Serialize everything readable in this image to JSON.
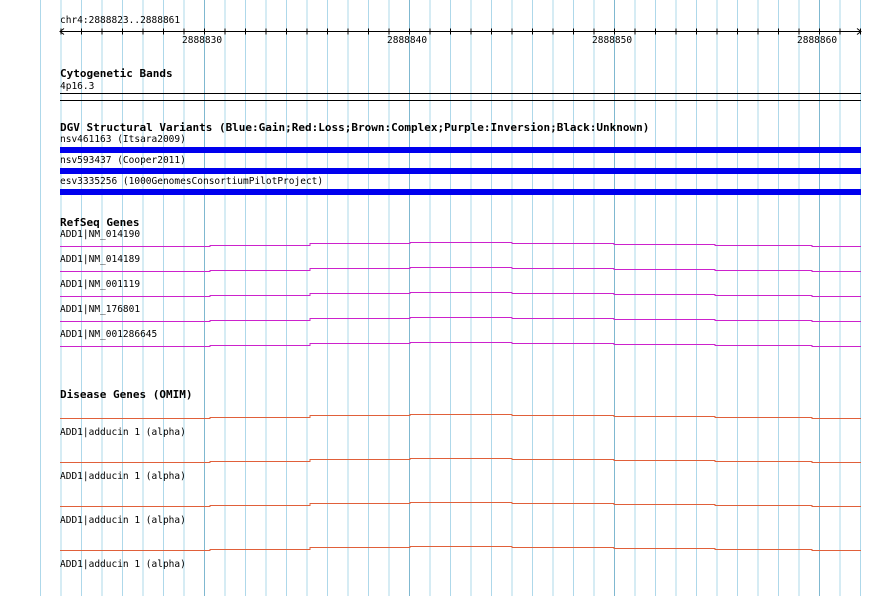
{
  "location": "chr4:2888823..2888861",
  "ruler": {
    "tick_labels": [
      "2888830",
      "2888840",
      "2888850",
      "2888860"
    ]
  },
  "tracks": {
    "cytoband": {
      "title": "Cytogenetic Bands",
      "band": "4p16.3"
    },
    "dgv": {
      "title": "DGV Structural Variants (Blue:Gain;Red:Loss;Brown:Complex;Purple:Inversion;Black:Unknown)",
      "features": [
        {
          "label": "nsv461163 (Itsara2009)",
          "color": "#0000ee"
        },
        {
          "label": "nsv593437 (Cooper2011)",
          "color": "#0000ee"
        },
        {
          "label": "esv3335256 (1000GenomesConsortiumPilotProject)",
          "color": "#0000ee"
        }
      ]
    },
    "refseq": {
      "title": "RefSeq Genes",
      "color": "#cc22cc",
      "features": [
        {
          "label": "ADD1|NM_014190"
        },
        {
          "label": "ADD1|NM_014189"
        },
        {
          "label": "ADD1|NM_001119"
        },
        {
          "label": "ADD1|NM_176801"
        },
        {
          "label": "ADD1|NM_001286645"
        }
      ]
    },
    "omim": {
      "title": "Disease Genes (OMIM)",
      "color": "#e0603a",
      "features": [
        {
          "label": "ADD1|adducin 1 (alpha)"
        },
        {
          "label": "ADD1|adducin 1 (alpha)"
        },
        {
          "label": "ADD1|adducin 1 (alpha)"
        },
        {
          "label": "ADD1|adducin 1 (alpha)"
        }
      ]
    }
  },
  "colors": {
    "grid_minor": "#aed8ea",
    "grid_major": "#7fb8d0",
    "background": "#ffffff",
    "axis": "#000000"
  }
}
